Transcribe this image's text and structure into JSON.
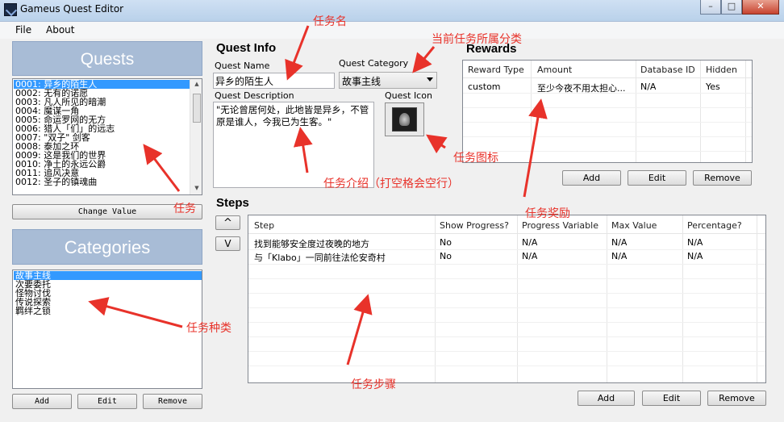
{
  "window": {
    "title": "Gameus Quest Editor",
    "controls": [
      "–",
      "□",
      "✕"
    ]
  },
  "menu": [
    "File",
    "About"
  ],
  "quests": {
    "header": "Quests",
    "items": [
      "0001: 异乡的陌生人",
      "0002: 无有的诺愿",
      "0003: 凡人所见的暗潮",
      "0004: 魔谋一角",
      "0005: 命运罗网的无方",
      "0006: 猎人「们」的远志",
      "0007: \"双子\" 剑客",
      "0008: 泰加之环",
      "0009: 这是我们的世界",
      "0010: 净土的永远公爵",
      "0011: 追风决意",
      "0012: 圣子的镇魂曲"
    ],
    "change_value": "Change Value"
  },
  "categories": {
    "header": "Categories",
    "items": [
      "故事主线",
      "次要委托",
      "怪物讨伐",
      "传说探索",
      "羁绊之锁"
    ],
    "buttons": {
      "add": "Add",
      "edit": "Edit",
      "remove": "Remove"
    }
  },
  "quest_info": {
    "title": "Quest Info",
    "name_label": "Quest Name",
    "name_value": "异乡的陌生人",
    "category_label": "Quest Category",
    "category_value": "故事主线",
    "description_label": "Quest Description",
    "description_value": "\"无论曾居何处，此地皆是异乡，不管原是谁人，今我已为生客。\"",
    "icon_label": "Quest Icon"
  },
  "rewards": {
    "title": "Rewards",
    "columns": [
      "Reward Type",
      "Amount",
      "Database ID",
      "Hidden"
    ],
    "rows": [
      [
        "custom",
        "至少今夜不用太担心...",
        "N/A",
        "Yes"
      ]
    ],
    "buttons": {
      "add": "Add",
      "edit": "Edit",
      "remove": "Remove"
    }
  },
  "steps": {
    "title": "Steps",
    "up": "^",
    "down": "V",
    "columns": [
      "Step",
      "Show Progress?",
      "Progress Variable",
      "Max Value",
      "Percentage?"
    ],
    "rows": [
      [
        "找到能够安全度过夜晚的地方",
        "No",
        "N/A",
        "N/A",
        "N/A"
      ],
      [
        "与「Klabo」一同前往法伦安奇村",
        "No",
        "N/A",
        "N/A",
        "N/A"
      ]
    ],
    "buttons": {
      "add": "Add",
      "edit": "Edit",
      "remove": "Remove"
    }
  },
  "annotations": {
    "quest_name": "任务名",
    "category": "当前任务所属分类",
    "icon": "任务图标",
    "description": "任务介绍（打空格会空行）",
    "rewards": "任务奖励",
    "quests": "任务",
    "categories": "任务种类",
    "steps": "任务步骤"
  },
  "colors": {
    "selection": "#3399ff",
    "header_bg": "#a8bcd6",
    "annotation": "#e8322a"
  }
}
